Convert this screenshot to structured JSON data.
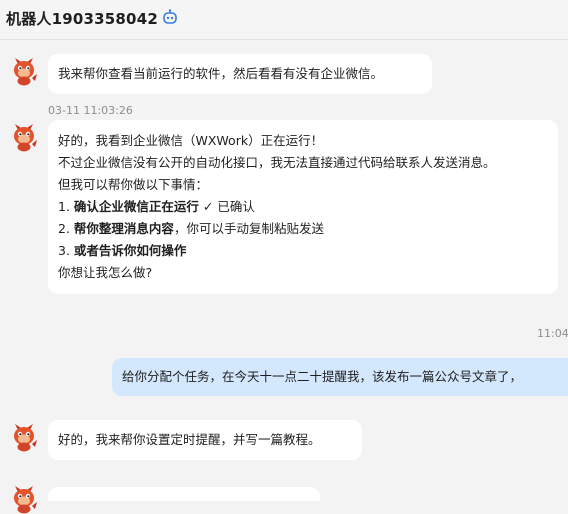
{
  "header": {
    "title": "机器人1903358042",
    "bot_icon": "robot-icon"
  },
  "messages": {
    "m1": {
      "sender": "bot",
      "text": "我来帮你查看当前运行的软件，然后看看有没有企业微信。"
    },
    "ts1": "03-11 11:03:26",
    "m2": {
      "sender": "bot",
      "line1": "好的，我看到企业微信（WXWork）正在运行！",
      "line2": "不过企业微信没有公开的自动化接口，我无法直接通过代码给联系人发送消息。",
      "line3": "但我可以帮你做以下事情：",
      "item1_num": "1.",
      "item1_bold": "确认企业微信正在运行",
      "item1_rest": " ✓ 已确认",
      "item2_num": "2.",
      "item2_bold": "帮你整理消息内容",
      "item2_rest": "，你可以手动复制粘贴发送",
      "item3_num": "3.",
      "item3_bold": "或者告诉你如何操作",
      "line_last": "你想让我怎么做?"
    },
    "ts2": "11:04",
    "m3": {
      "sender": "user",
      "text": "给你分配个任务，在今天十一点二十提醒我，该发布一篇公众号文章了，"
    },
    "m4": {
      "sender": "bot",
      "text": "好的，我来帮你设置定时提醒，并写一篇教程。"
    }
  },
  "colors": {
    "background": "#f3f3f3",
    "bot_bubble": "#ffffff",
    "user_bubble": "#d3e7fd",
    "accent": "#3a7be0"
  }
}
